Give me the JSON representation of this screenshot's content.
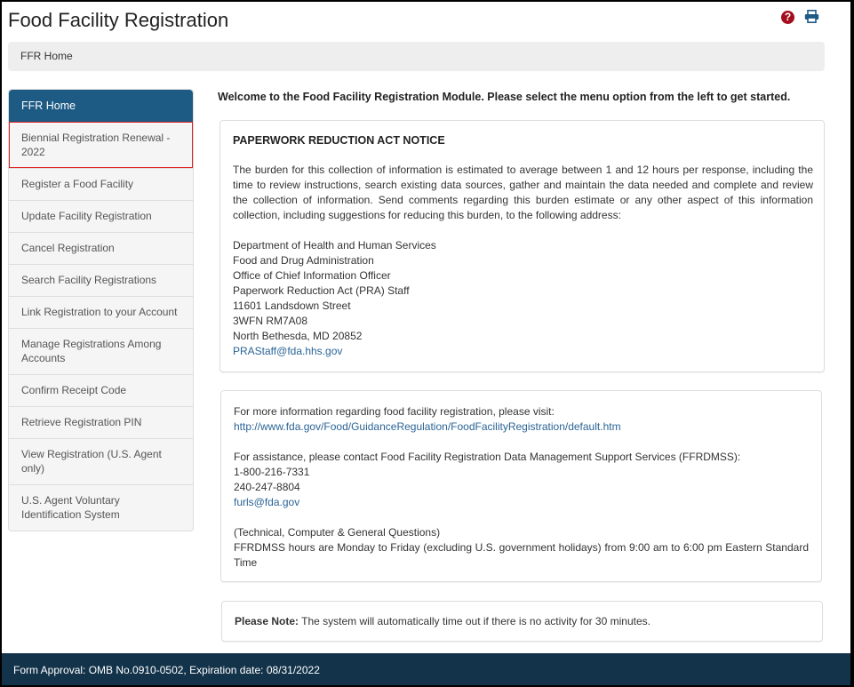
{
  "header": {
    "title": "Food Facility Registration",
    "help_icon": "question-circle-icon",
    "print_icon": "print-icon"
  },
  "breadcrumb": {
    "current": "FFR Home"
  },
  "sidebar": {
    "header": "FFR Home",
    "items": [
      {
        "label": "Biennial Registration Renewal - 2022",
        "highlighted": true
      },
      {
        "label": "Register a Food Facility"
      },
      {
        "label": "Update Facility Registration"
      },
      {
        "label": "Cancel Registration"
      },
      {
        "label": "Search Facility Registrations"
      },
      {
        "label": "Link Registration to your Account"
      },
      {
        "label": "Manage Registrations Among Accounts"
      },
      {
        "label": "Confirm Receipt Code"
      },
      {
        "label": "Retrieve Registration PIN"
      },
      {
        "label": "View Registration (U.S. Agent only)"
      },
      {
        "label": "U.S. Agent Voluntary Identification System"
      }
    ]
  },
  "main": {
    "welcome": "Welcome to the Food Facility Registration Module. Please select the menu option from the left to get started.",
    "pra": {
      "title": "PAPERWORK REDUCTION ACT NOTICE",
      "text": "The burden for this collection of information is estimated to average between 1 and 12 hours per response, including the time to review instructions, search existing data sources, gather and maintain the data needed and complete and review the collection of information. Send comments regarding this burden estimate or any other aspect of this information collection, including suggestions for reducing this burden, to the following address:",
      "address": [
        "Department of Health and Human Services",
        "Food and Drug Administration",
        "Office of Chief Information Officer",
        "Paperwork Reduction Act (PRA) Staff",
        "11601 Landsdown Street",
        "3WFN RM7A08",
        "North Bethesda, MD 20852"
      ],
      "email": "PRAStaff@fda.hhs.gov"
    },
    "info": {
      "more_info": "For more information regarding food facility registration, please visit:",
      "url": "http://www.fda.gov/Food/GuidanceRegulation/FoodFacilityRegistration/default.htm",
      "assistance": "For assistance, please contact Food Facility Registration Data Management Support Services (FFRDMSS):",
      "phone1": "1-800-216-7331",
      "phone2": "240-247-8804",
      "email": "furls@fda.gov",
      "questions": "(Technical, Computer & General Questions)",
      "hours": "FFRDMSS hours are Monday to Friday (excluding U.S. government holidays) from 9:00 am to 6:00 pm Eastern Standard Time"
    },
    "note": {
      "label": "Please Note:",
      "text": " The system will automatically time out if there is no activity for 30 minutes."
    }
  },
  "footer": {
    "text": "Form Approval: OMB No.0910-0502, Expiration date: 08/31/2022"
  },
  "colors": {
    "primary": "#1d5a84",
    "footer": "#13334a",
    "help": "#a30d1e",
    "link": "#2a6496",
    "highlight": "#e02020"
  }
}
